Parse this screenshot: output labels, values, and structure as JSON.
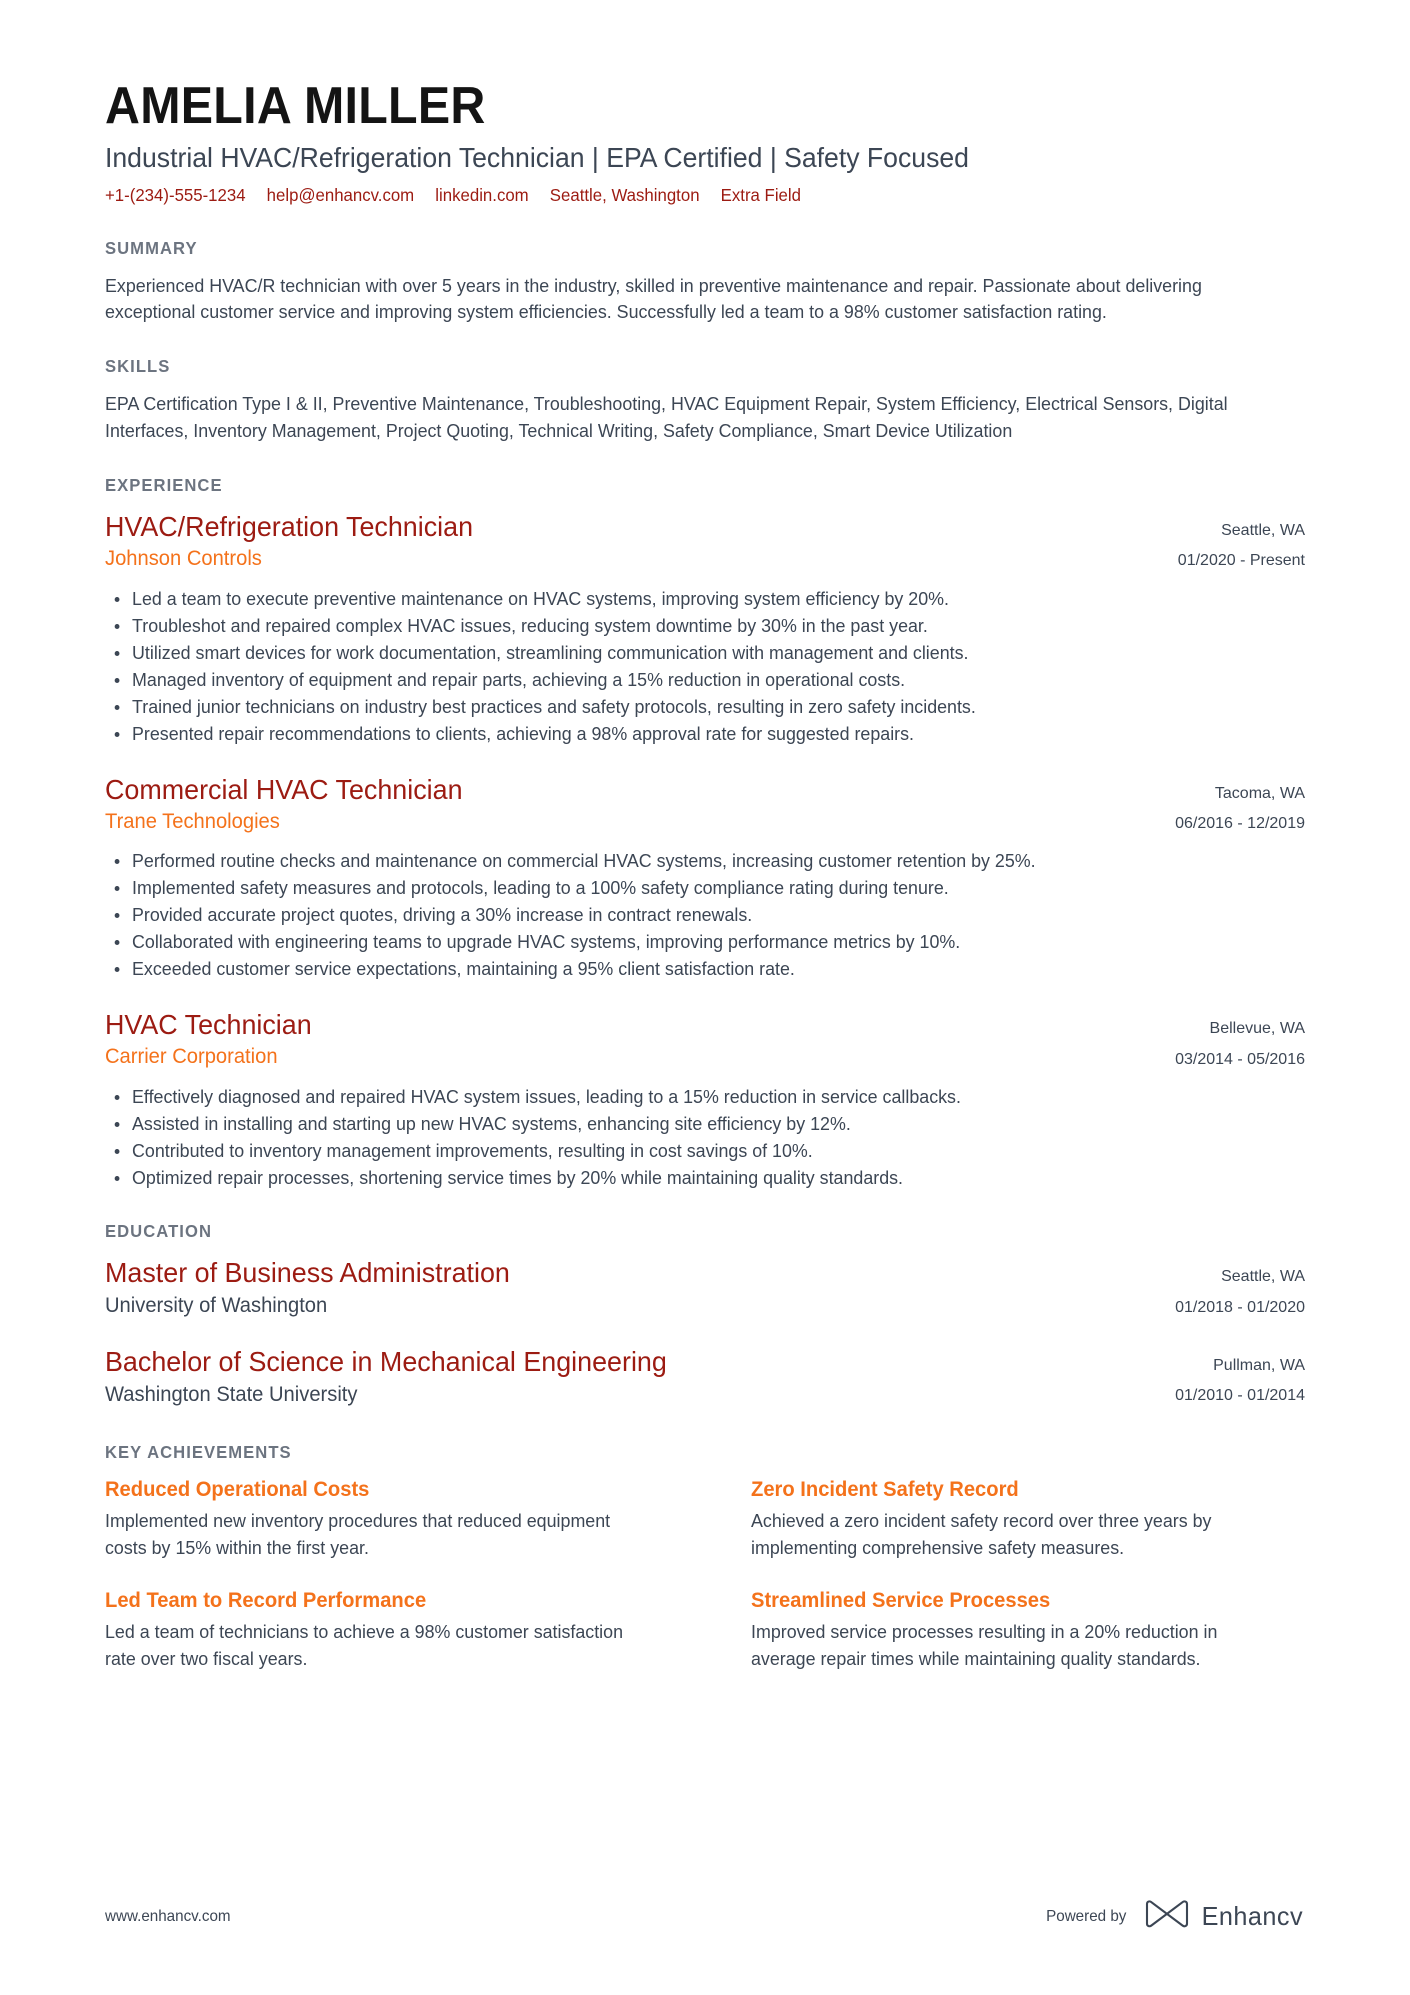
{
  "header": {
    "name": "AMELIA MILLER",
    "headline": "Industrial HVAC/Refrigeration Technician | EPA Certified | Safety Focused",
    "contacts": [
      {
        "name": "phone",
        "text": "+1-(234)-555-1234"
      },
      {
        "name": "email",
        "text": "help@enhancv.com"
      },
      {
        "name": "linkedin",
        "text": "linkedin.com"
      },
      {
        "name": "location",
        "text": "Seattle, Washington"
      },
      {
        "name": "extra-field",
        "text": "Extra Field"
      }
    ]
  },
  "summary": {
    "title": "SUMMARY",
    "text": "Experienced HVAC/R technician with over 5 years in the industry, skilled in preventive maintenance and repair. Passionate about delivering exceptional customer service and improving system efficiencies. Successfully led a team to a 98% customer satisfaction rating."
  },
  "skills": {
    "title": "SKILLS",
    "text": "EPA Certification Type I & II, Preventive Maintenance, Troubleshooting, HVAC Equipment Repair, System Efficiency, Electrical Sensors, Digital Interfaces, Inventory Management, Project Quoting, Technical Writing, Safety Compliance, Smart Device Utilization"
  },
  "experience": {
    "title": "EXPERIENCE",
    "entries": [
      {
        "title": "HVAC/Refrigeration Technician",
        "org": "Johnson Controls",
        "location": "Seattle, WA",
        "dates": "01/2020 - Present",
        "bullets": [
          "Led a team to execute preventive maintenance on HVAC systems, improving system efficiency by 20%.",
          "Troubleshot and repaired complex HVAC issues, reducing system downtime by 30% in the past year.",
          "Utilized smart devices for work documentation, streamlining communication with management and clients.",
          "Managed inventory of equipment and repair parts, achieving a 15% reduction in operational costs.",
          "Trained junior technicians on industry best practices and safety protocols, resulting in zero safety incidents.",
          "Presented repair recommendations to clients, achieving a 98% approval rate for suggested repairs."
        ]
      },
      {
        "title": "Commercial HVAC Technician",
        "org": "Trane Technologies",
        "location": "Tacoma, WA",
        "dates": "06/2016 - 12/2019",
        "bullets": [
          "Performed routine checks and maintenance on commercial HVAC systems, increasing customer retention by 25%.",
          "Implemented safety measures and protocols, leading to a 100% safety compliance rating during tenure.",
          "Provided accurate project quotes, driving a 30% increase in contract renewals.",
          "Collaborated with engineering teams to upgrade HVAC systems, improving performance metrics by 10%.",
          "Exceeded customer service expectations, maintaining a 95% client satisfaction rate."
        ]
      },
      {
        "title": "HVAC Technician",
        "org": "Carrier Corporation",
        "location": "Bellevue, WA",
        "dates": "03/2014 - 05/2016",
        "bullets": [
          "Effectively diagnosed and repaired HVAC system issues, leading to a 15% reduction in service callbacks.",
          "Assisted in installing and starting up new HVAC systems, enhancing site efficiency by 12%.",
          "Contributed to inventory management improvements, resulting in cost savings of 10%.",
          "Optimized repair processes, shortening service times by 20% while maintaining quality standards."
        ]
      }
    ]
  },
  "education": {
    "title": "EDUCATION",
    "entries": [
      {
        "degree": "Master of Business Administration",
        "school": "University of Washington",
        "location": "Seattle, WA",
        "dates": "01/2018 - 01/2020"
      },
      {
        "degree": "Bachelor of Science in Mechanical Engineering",
        "school": "Washington State University",
        "location": "Pullman, WA",
        "dates": "01/2010 - 01/2014"
      }
    ]
  },
  "achievements": {
    "title": "KEY ACHIEVEMENTS",
    "items": [
      {
        "title": "Reduced Operational Costs",
        "desc": "Implemented new inventory procedures that reduced equipment costs by 15% within the first year."
      },
      {
        "title": "Zero Incident Safety Record",
        "desc": "Achieved a zero incident safety record over three years by implementing comprehensive safety measures."
      },
      {
        "title": "Led Team to Record Performance",
        "desc": "Led a team of technicians to achieve a 98% customer satisfaction rate over two fiscal years."
      },
      {
        "title": "Streamlined Service Processes",
        "desc": "Improved service processes resulting in a 20% reduction in average repair times while maintaining quality standards."
      }
    ]
  },
  "footer": {
    "url": "www.enhancv.com",
    "powered_by": "Powered by",
    "brand": "Enhancv"
  },
  "colors": {
    "accent_red": "#9c1b12",
    "accent_orange": "#f4721b",
    "body_text": "#3c4654",
    "section_heading": "#6c7480",
    "name": "#141414"
  }
}
